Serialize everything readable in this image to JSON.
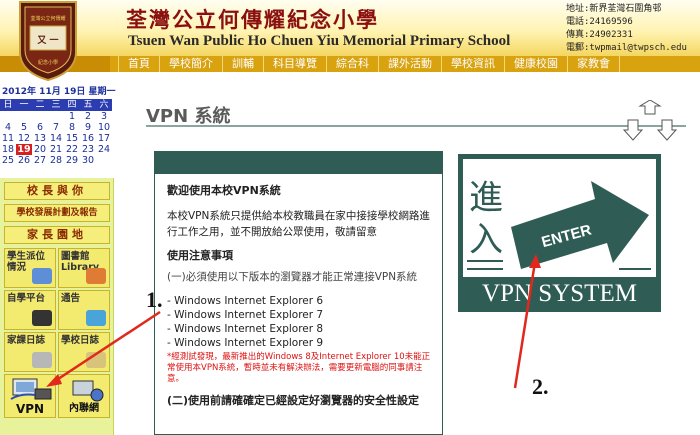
{
  "header": {
    "school_name_cn": "荃灣公立何傳耀紀念小學",
    "school_name_en": "Tsuen Wan Public Ho Chuen Yiu Memorial Primary School",
    "contact": [
      "地址:新界荃灣石圍角邨",
      "電話:24169596",
      "傳真:24902331",
      "電郵:twpmail@twpsch.edu"
    ],
    "logo_text": "荃灣公立何傳耀紀念小學"
  },
  "nav": {
    "items": [
      "首頁",
      "學校簡介",
      "訓輔",
      "科目導覽",
      "綜合科",
      "課外活動",
      "學校資訊",
      "健康校園",
      "家教會"
    ]
  },
  "calendar": {
    "title": "2012年 11月 19日 星期一",
    "weekdays": [
      "日",
      "一",
      "二",
      "三",
      "四",
      "五",
      "六"
    ],
    "weeks": [
      [
        "",
        "",
        "",
        "",
        "1",
        "2",
        "3"
      ],
      [
        "4",
        "5",
        "6",
        "7",
        "8",
        "9",
        "10"
      ],
      [
        "11",
        "12",
        "13",
        "14",
        "15",
        "16",
        "17"
      ],
      [
        "18",
        "19",
        "20",
        "21",
        "22",
        "23",
        "24"
      ],
      [
        "25",
        "26",
        "27",
        "28",
        "29",
        "30",
        ""
      ]
    ],
    "today": "19"
  },
  "left_menu": {
    "band1": "校長與你",
    "band2": "學校發展計劃及報告",
    "band3": "家長園地",
    "tiles": [
      {
        "label": "學生派位情況"
      },
      {
        "label": "圖書館 Library"
      },
      {
        "label": "自學平台"
      },
      {
        "label": "通告"
      },
      {
        "label": "家課日誌"
      },
      {
        "label": "學校日誌"
      },
      {
        "label": "VPN"
      },
      {
        "label": "內聯網"
      }
    ]
  },
  "main": {
    "page_title": "VPN 系統",
    "welcome": "歡迎使用本校VPN系統",
    "intro": "本校VPN系統只提供給本校教職員在家中接接學校網路進行工作之用，並不開放給公眾使用，敬請留意",
    "notice_heading": "使用注意事項",
    "sub_heading": "(一)必須使用以下版本的瀏覽器才能正常連接VPN系統",
    "browsers": [
      "- Windows Internet Explorer 6",
      "- Windows Internet Explorer 7",
      "- Windows Internet Explorer 8",
      "- Windows Internet Explorer 9"
    ],
    "warning": "*經測試發現，最新推出的Windows 8及Internet Explorer 10未能正常使用本VPN系統，暫時並未有解決辦法，需要更新電腦的同事請注意。",
    "section2": "(二)使用前請確確定已經設定好瀏覽器的安全性設定"
  },
  "vpn_banner": {
    "cn_text": "進入",
    "enter_label": "ENTER",
    "system_label": "VPN SYSTEM"
  },
  "annotations": {
    "label1": "1.",
    "label2": "2."
  },
  "colors": {
    "header_gold": "#f3d35a",
    "nav_gold": "#d9a20f",
    "school_red": "#8a1010",
    "vpn_green": "#2f5d55",
    "calendar_blue": "#2c3db1",
    "arrow_red": "#e0281c"
  }
}
